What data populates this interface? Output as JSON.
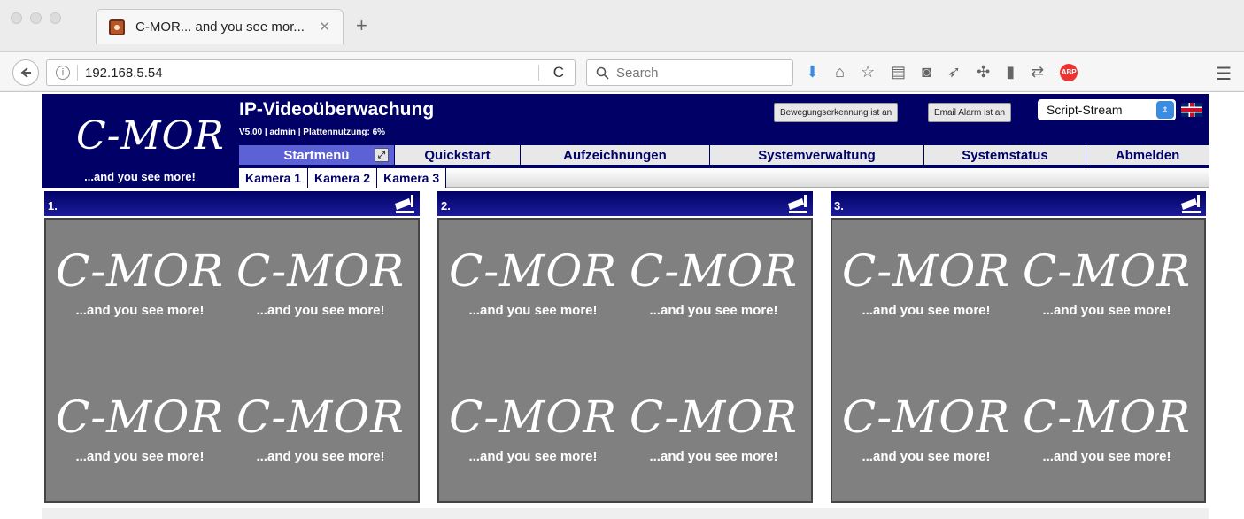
{
  "browser": {
    "tab_title": "C-MOR... and you see mor...",
    "tab_close": "✕",
    "new_tab": "+",
    "url": "192.168.5.54",
    "search_placeholder": "Search",
    "info_icon": "i",
    "reload_icon": "C",
    "menu_icon": "☰",
    "abp_label": "ABP"
  },
  "header": {
    "logo": "C-MOR",
    "logo_tagline": "...and you see more!",
    "title": "IP-Videoüberwachung",
    "info": "V5.00 | admin | Plattennutzung: 6%",
    "motion_detection": "Bewegungserkennung ist an",
    "email_alarm": "Email Alarm ist an",
    "stream_select": "Script-Stream"
  },
  "main_nav": [
    {
      "label": "Startmenü",
      "active": true
    },
    {
      "label": "Quickstart",
      "active": false
    },
    {
      "label": "Aufzeichnungen",
      "active": false
    },
    {
      "label": "Systemverwaltung",
      "active": false
    },
    {
      "label": "Systemstatus",
      "active": false
    },
    {
      "label": "Abmelden",
      "active": false
    }
  ],
  "sub_nav": [
    "Kamera 1",
    "Kamera 2",
    "Kamera 3"
  ],
  "cameras": [
    {
      "label": "1.",
      "placeholder_logo": "C-MOR",
      "placeholder_tagline": "...and you see more!"
    },
    {
      "label": "2.",
      "placeholder_logo": "C-MOR",
      "placeholder_tagline": "...and you see more!"
    },
    {
      "label": "3.",
      "placeholder_logo": "C-MOR",
      "placeholder_tagline": "...and you see more!"
    }
  ],
  "colors": {
    "brand_navy": "#010066",
    "active_tab": "#5c61d6",
    "feed_gray": "#808080"
  }
}
